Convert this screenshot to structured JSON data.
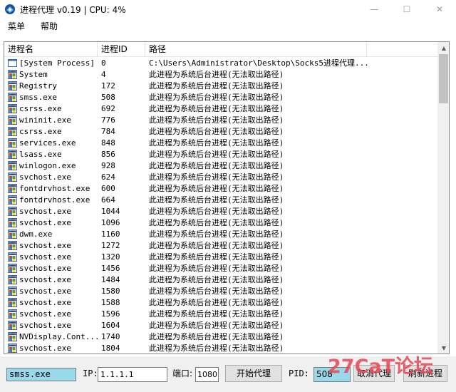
{
  "window": {
    "title": "进程代理 v0.19 | CPU: 4%",
    "controls": {
      "minimize": "—",
      "maximize": "☐",
      "close": "✕"
    }
  },
  "menu": {
    "items": [
      "菜单",
      "帮助"
    ]
  },
  "list": {
    "columns": [
      "进程名",
      "进程ID",
      "路径"
    ],
    "rows": [
      {
        "name": "[System Process]",
        "pid": "0",
        "path": "C:\\Users\\Administrator\\Desktop\\Socks5进程代理...",
        "icon": "window-icon"
      },
      {
        "name": "System",
        "pid": "4",
        "path": "此进程为系统后台进程(无法取出路径)",
        "icon": "app-icon"
      },
      {
        "name": "Registry",
        "pid": "172",
        "path": "此进程为系统后台进程(无法取出路径)",
        "icon": "app-icon"
      },
      {
        "name": "smss.exe",
        "pid": "508",
        "path": "此进程为系统后台进程(无法取出路径)",
        "icon": "app-icon"
      },
      {
        "name": "csrss.exe",
        "pid": "692",
        "path": "此进程为系统后台进程(无法取出路径)",
        "icon": "app-icon"
      },
      {
        "name": "wininit.exe",
        "pid": "776",
        "path": "此进程为系统后台进程(无法取出路径)",
        "icon": "app-icon"
      },
      {
        "name": "csrss.exe",
        "pid": "784",
        "path": "此进程为系统后台进程(无法取出路径)",
        "icon": "app-icon"
      },
      {
        "name": "services.exe",
        "pid": "848",
        "path": "此进程为系统后台进程(无法取出路径)",
        "icon": "app-icon"
      },
      {
        "name": "lsass.exe",
        "pid": "856",
        "path": "此进程为系统后台进程(无法取出路径)",
        "icon": "app-icon"
      },
      {
        "name": "winlogon.exe",
        "pid": "928",
        "path": "此进程为系统后台进程(无法取出路径)",
        "icon": "app-icon"
      },
      {
        "name": "svchost.exe",
        "pid": "624",
        "path": "此进程为系统后台进程(无法取出路径)",
        "icon": "app-icon"
      },
      {
        "name": "fontdrvhost.exe",
        "pid": "600",
        "path": "此进程为系统后台进程(无法取出路径)",
        "icon": "app-icon"
      },
      {
        "name": "fontdrvhost.exe",
        "pid": "664",
        "path": "此进程为系统后台进程(无法取出路径)",
        "icon": "app-icon"
      },
      {
        "name": "svchost.exe",
        "pid": "1044",
        "path": "此进程为系统后台进程(无法取出路径)",
        "icon": "app-icon"
      },
      {
        "name": "svchost.exe",
        "pid": "1096",
        "path": "此进程为系统后台进程(无法取出路径)",
        "icon": "app-icon"
      },
      {
        "name": "dwm.exe",
        "pid": "1160",
        "path": "此进程为系统后台进程(无法取出路径)",
        "icon": "app-icon"
      },
      {
        "name": "svchost.exe",
        "pid": "1272",
        "path": "此进程为系统后台进程(无法取出路径)",
        "icon": "app-icon"
      },
      {
        "name": "svchost.exe",
        "pid": "1320",
        "path": "此进程为系统后台进程(无法取出路径)",
        "icon": "app-icon"
      },
      {
        "name": "svchost.exe",
        "pid": "1456",
        "path": "此进程为系统后台进程(无法取出路径)",
        "icon": "app-icon"
      },
      {
        "name": "svchost.exe",
        "pid": "1484",
        "path": "此进程为系统后台进程(无法取出路径)",
        "icon": "app-icon"
      },
      {
        "name": "svchost.exe",
        "pid": "1580",
        "path": "此进程为系统后台进程(无法取出路径)",
        "icon": "app-icon"
      },
      {
        "name": "svchost.exe",
        "pid": "1588",
        "path": "此进程为系统后台进程(无法取出路径)",
        "icon": "app-icon"
      },
      {
        "name": "svchost.exe",
        "pid": "1596",
        "path": "此进程为系统后台进程(无法取出路径)",
        "icon": "app-icon"
      },
      {
        "name": "svchost.exe",
        "pid": "1604",
        "path": "此进程为系统后台进程(无法取出路径)",
        "icon": "app-icon"
      },
      {
        "name": "NVDisplay.Cont...",
        "pid": "1740",
        "path": "此进程为系统后台进程(无法取出路径)",
        "icon": "app-icon"
      },
      {
        "name": "svchost.exe",
        "pid": "1804",
        "path": "此进程为系统后台进程(无法取出路径)",
        "icon": "app-icon"
      }
    ]
  },
  "controls": {
    "process_field": "smss.exe",
    "ip_label": "IP:",
    "ip_value": "1.1.1.1",
    "port_label": "端口:",
    "port_value": "1080",
    "start_button": "开始代理",
    "pid_label": "PID:",
    "pid_value": "508",
    "cancel_button": "取消代理",
    "refresh_button": "刷新进程"
  },
  "watermark": "27CaT论坛",
  "colors": {
    "selected_field": "#99d9ea",
    "watermark": "#e94a5a",
    "button_face": "#e1e1e1",
    "panel": "#f0f0f0"
  }
}
